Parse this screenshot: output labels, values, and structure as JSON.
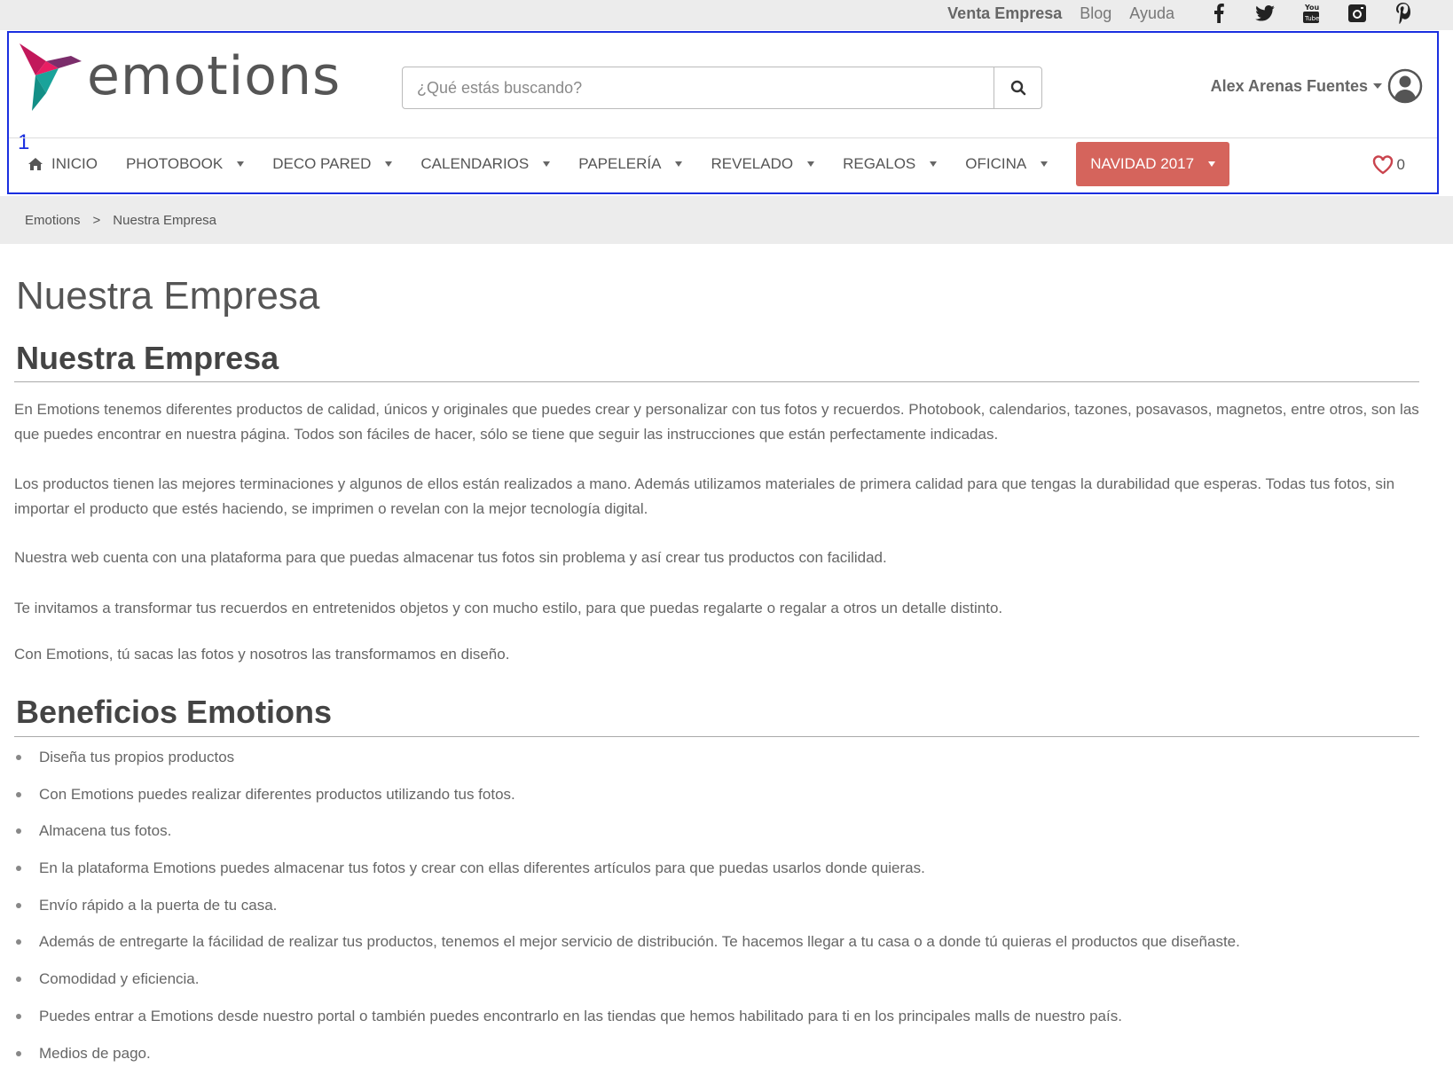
{
  "topbar": {
    "links": [
      "Venta Empresa",
      "Blog",
      "Ayuda"
    ],
    "social_icons": [
      "facebook-icon",
      "twitter-icon",
      "youtube-icon",
      "instagram-icon",
      "pinterest-icon"
    ]
  },
  "header": {
    "annotation": "1",
    "logo_text": "emotions",
    "search": {
      "placeholder": "¿Qué estás buscando?"
    },
    "user": {
      "name": "Alex Arenas Fuentes"
    },
    "favorites_count": "0"
  },
  "nav": {
    "items": [
      {
        "label": "INICIO"
      },
      {
        "label": "PHOTOBOOK"
      },
      {
        "label": "DECO PARED"
      },
      {
        "label": "CALENDARIOS"
      },
      {
        "label": "PAPELERÍA"
      },
      {
        "label": "REVELADO"
      },
      {
        "label": "REGALOS"
      },
      {
        "label": "OFICINA"
      },
      {
        "label": "NAVIDAD 2017"
      }
    ]
  },
  "breadcrumb": {
    "home": "Emotions",
    "sep": ">",
    "current": "Nuestra Empresa"
  },
  "content": {
    "page_title": "Nuestra Empresa",
    "section1_title": "Nuestra Empresa",
    "paragraphs": [
      "En Emotions tenemos diferentes productos de calidad, únicos y originales que puedes crear y personalizar con tus fotos y recuerdos. Photobook, calendarios, tazones, posavasos, magnetos, entre otros, son las que puedes encontrar en nuestra página. Todos son fáciles de hacer, sólo se tiene que seguir las instrucciones que están perfectamente indicadas.",
      "Los productos tienen las mejores terminaciones y algunos de ellos están realizados a mano. Además utilizamos materiales de primera calidad para que tengas la durabilidad que esperas. Todas tus fotos, sin importar el producto que estés haciendo, se imprimen o revelan con la mejor tecnología digital.",
      "Nuestra web cuenta con una plataforma para que puedas almacenar tus fotos sin problema y así crear tus productos con facilidad.",
      "Te invitamos a transformar tus recuerdos en entretenidos objetos y con mucho estilo, para que puedas regalarte o regalar a otros un detalle distinto.",
      "Con Emotions, tú sacas las fotos y nosotros las transformamos en diseño."
    ],
    "section2_title": "Beneficios Emotions",
    "bullets": [
      "Diseña tus propios productos",
      "Con Emotions puedes realizar diferentes productos utilizando tus fotos.",
      "Almacena tus fotos.",
      "En la plataforma Emotions puedes almacenar tus fotos y crear con ellas diferentes artículos para que puedas usarlos donde quieras.",
      "Envío rápido a la puerta de tu casa.",
      "Además de entregarte la fácilidad de realizar tus productos, tenemos el mejor servicio de distribución. Te hacemos llegar a tu casa o a donde tú quieras el productos que diseñaste.",
      "Comodidad y eficiencia.",
      "Puedes entrar a Emotions desde nuestro portal o también puedes encontrarlo en las tiendas que hemos habilitado para ti en los principales malls de nuestro país.",
      "Medios de pago."
    ]
  },
  "colors": {
    "accent_christmas": "#d5645c",
    "annotation_blue": "#1a2fe0",
    "logo_magenta": "#c2185b",
    "logo_teal": "#1aa39a"
  }
}
